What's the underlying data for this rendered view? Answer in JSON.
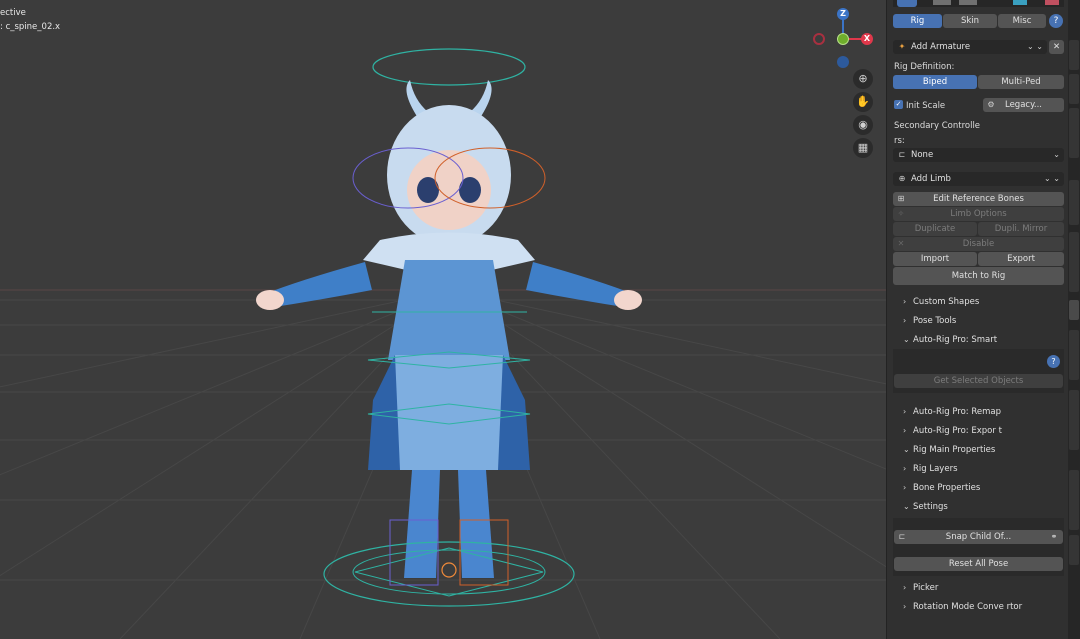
{
  "viewport": {
    "view_label": "ective",
    "object_label": ": c_spine_02.x",
    "gizmo": {
      "z": "Z",
      "x": "X",
      "y": ""
    },
    "colors": {
      "x": "#e0384b",
      "y": "#6fae2c",
      "z": "#3b74c6",
      "background": "#3c3c3c"
    }
  },
  "sidebar": {
    "tabs": {
      "rig": "Rig",
      "skin": "Skin",
      "misc": "Misc",
      "help": "?"
    },
    "armature": {
      "label": "Add Armature",
      "close": "✕"
    },
    "rig_definition": {
      "label": "Rig Definition:",
      "biped": "Biped",
      "multi_ped": "Multi-Ped"
    },
    "init_scale": {
      "label": "Init Scale",
      "checked": true
    },
    "legacy": "Legacy...",
    "secondary": {
      "label1": "Secondary Controlle",
      "label2": "rs:",
      "value": "None"
    },
    "limb": {
      "label": "Add Limb"
    },
    "buttons": {
      "edit_ref_bones": "Edit Reference Bones",
      "limb_options": "Limb Options",
      "duplicate": "Duplicate",
      "dupli_mirror": "Dupli. Mirror",
      "disable": "Disable",
      "import": "Import",
      "export": "Export",
      "match_to_rig": "Match to Rig",
      "get_selected": "Get Selected Objects",
      "snap_child_of": "Snap Child Of...",
      "reset_all_pose": "Reset All Pose"
    },
    "panels": {
      "custom_shapes": "Custom Shapes",
      "pose_tools": "Pose Tools",
      "smart": "Auto-Rig Pro: Smart",
      "remap": "Auto-Rig Pro: Remap",
      "export": "Auto-Rig Pro: Expor   t",
      "rig_main": "Rig Main Properties",
      "rig_layers": "Rig Layers",
      "bone_props": "Bone Properties",
      "settings": "Settings",
      "picker": "Picker",
      "rotation_mode": "Rotation Mode Conve    rtor"
    },
    "accent": "#4772b3"
  }
}
